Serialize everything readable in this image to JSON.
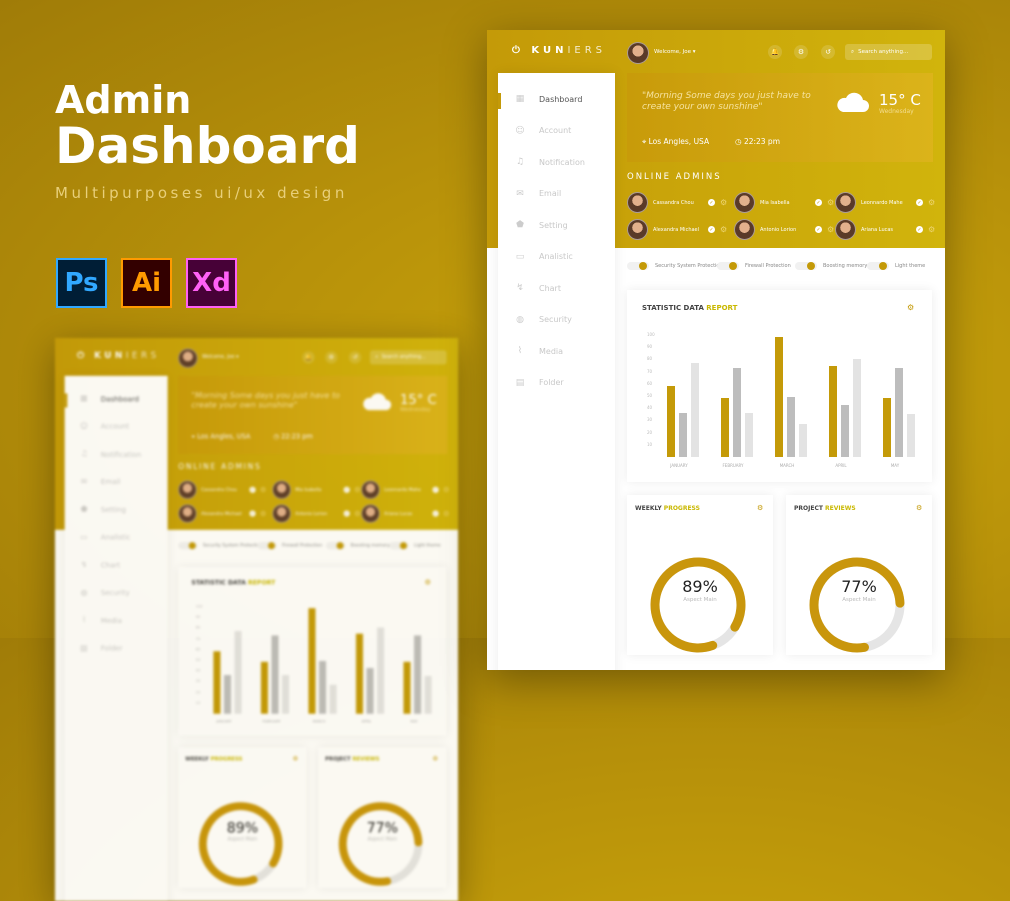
{
  "hero": {
    "title_line1": "Admin",
    "title_line2": "Dashboard",
    "subtitle": "Multipurposes ui/ux design",
    "apps": [
      {
        "label": "Ps",
        "color": "#31a8ff",
        "bg": "#001e36"
      },
      {
        "label": "Ai",
        "color": "#ff9a00",
        "bg": "#330000"
      },
      {
        "label": "Xd",
        "color": "#ff61f6",
        "bg": "#470137"
      }
    ]
  },
  "header": {
    "logo_bold": "KUN",
    "logo_light": "IERS",
    "welcome": "Welcome, Joe ▾",
    "search_placeholder": "Search anything..."
  },
  "sidebar": {
    "items": [
      {
        "label": "Dashboard",
        "icon": "grid-icon",
        "active": true
      },
      {
        "label": "Account",
        "icon": "user-icon"
      },
      {
        "label": "Notification",
        "icon": "bell-icon"
      },
      {
        "label": "Email",
        "icon": "mail-icon"
      },
      {
        "label": "Setting",
        "icon": "shield-icon"
      },
      {
        "label": "Analistic",
        "icon": "monitor-icon"
      },
      {
        "label": "Chart",
        "icon": "chart-icon"
      },
      {
        "label": "Security",
        "icon": "lock-icon"
      },
      {
        "label": "Media",
        "icon": "paperclip-icon"
      },
      {
        "label": "Folder",
        "icon": "folder-icon"
      }
    ]
  },
  "weather": {
    "quote": "\"Morning Some days you just have to create your own sunshine\"",
    "temp": "15° C",
    "day": "Wednesday",
    "location": "Los Angles, USA",
    "time": "22:23 pm"
  },
  "online_admins": {
    "title": "ONLINE ADMINS",
    "admins": [
      {
        "name": "Cassandra Chou"
      },
      {
        "name": "Mia Isabella"
      },
      {
        "name": "Leonnardo Mahe"
      },
      {
        "name": "Alexandra Michael"
      },
      {
        "name": "Antonio Lorion"
      },
      {
        "name": "Ariana Lucas"
      }
    ]
  },
  "toggles": [
    {
      "label": "Security System Protections",
      "on": true
    },
    {
      "label": "Firewall Protection",
      "on": true
    },
    {
      "label": "Boosting memory",
      "on": true
    },
    {
      "label": "Light theme",
      "on": true
    }
  ],
  "chart_data": {
    "type": "bar",
    "title_dark": "STATISTIC DATA",
    "title_accent": "REPORT",
    "categories": [
      "JANUARY",
      "FEBRUARY",
      "MARCH",
      "APRIL",
      "MAY"
    ],
    "series": [
      {
        "values": [
          58,
          48,
          98,
          75,
          48
        ],
        "color": "#c49a08"
      },
      {
        "values": [
          36,
          73,
          49,
          43,
          73
        ],
        "color": "#bdbdbd"
      },
      {
        "values": [
          77,
          36,
          27,
          80,
          35
        ],
        "color": "#e3e3e3"
      }
    ],
    "ylim": [
      0,
      100
    ],
    "yticks": [
      10,
      20,
      30,
      40,
      50,
      60,
      70,
      80,
      90,
      100
    ],
    "grid": false
  },
  "weekly": {
    "title_dark": "WEEKLY",
    "title_accent": "PROGRESS",
    "percent": 89,
    "percent_label": "89%",
    "sub": "Aspect Main"
  },
  "reviews": {
    "title_dark": "PROJECT",
    "title_accent": "REVIEWS",
    "percent": 77,
    "percent_label": "77%",
    "sub": "Aspect Main"
  },
  "colors": {
    "accent": "#c49a08",
    "accent_light": "#c9b800"
  }
}
